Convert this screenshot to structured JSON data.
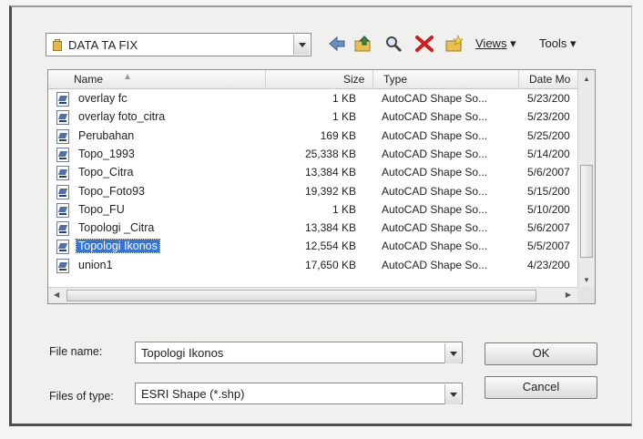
{
  "location": {
    "folder": "DATA TA FIX"
  },
  "toolbar": {
    "views_label": "Views",
    "tools_label": "Tools",
    "views_menu": "▾",
    "tools_menu": "▾"
  },
  "columns": {
    "name": "Name",
    "size": "Size",
    "type": "Type",
    "date": "Date Mo"
  },
  "files": [
    {
      "name": "overlay fc",
      "size": "1 KB",
      "type": "AutoCAD Shape So...",
      "date": "5/23/200"
    },
    {
      "name": "overlay foto_citra",
      "size": "1 KB",
      "type": "AutoCAD Shape So...",
      "date": "5/23/200"
    },
    {
      "name": "Perubahan",
      "size": "169 KB",
      "type": "AutoCAD Shape So...",
      "date": "5/25/200"
    },
    {
      "name": "Topo_1993",
      "size": "25,338 KB",
      "type": "AutoCAD Shape So...",
      "date": "5/14/200"
    },
    {
      "name": "Topo_Citra",
      "size": "13,384 KB",
      "type": "AutoCAD Shape So...",
      "date": "5/6/2007"
    },
    {
      "name": "Topo_Foto93",
      "size": "19,392 KB",
      "type": "AutoCAD Shape So...",
      "date": "5/15/200"
    },
    {
      "name": "Topo_FU",
      "size": "1 KB",
      "type": "AutoCAD Shape So...",
      "date": "5/10/200"
    },
    {
      "name": "Topologi _Citra",
      "size": "13,384 KB",
      "type": "AutoCAD Shape So...",
      "date": "5/6/2007"
    },
    {
      "name": "Topologi Ikonos",
      "size": "12,554 KB",
      "type": "AutoCAD Shape So...",
      "date": "5/5/2007",
      "selected": true
    },
    {
      "name": "union1",
      "size": "17,650 KB",
      "type": "AutoCAD Shape So...",
      "date": "4/23/200"
    }
  ],
  "form": {
    "file_name_label": "File name:",
    "file_name_value": "Topologi Ikonos",
    "file_type_label": "Files of type:",
    "file_type_value": "ESRI Shape (*.shp)",
    "ok_label": "OK",
    "cancel_label": "Cancel"
  }
}
